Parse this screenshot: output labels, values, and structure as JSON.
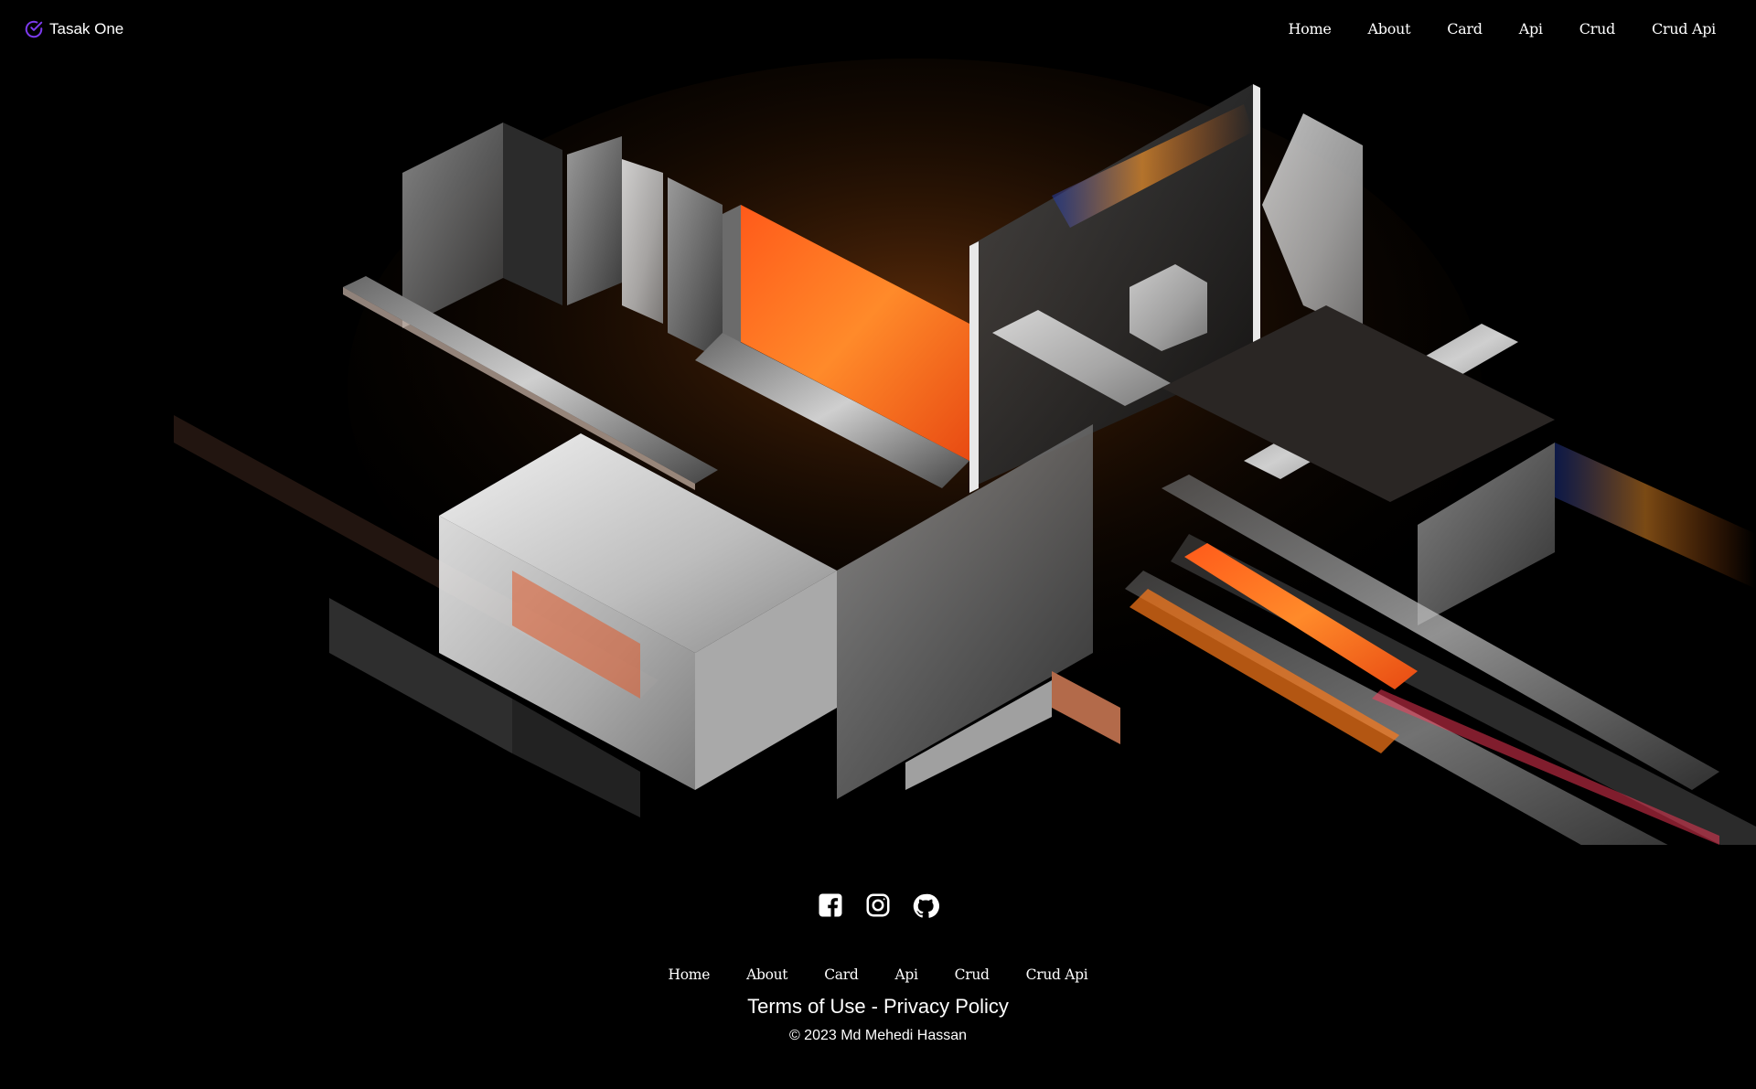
{
  "header": {
    "brand": {
      "name": "Tasak One",
      "icon": "check-circle-icon",
      "accent": "#7c3aed"
    },
    "nav": [
      {
        "label": "Home"
      },
      {
        "label": "About"
      },
      {
        "label": "Card"
      },
      {
        "label": "Api"
      },
      {
        "label": "Crud"
      },
      {
        "label": "Crud Api"
      }
    ]
  },
  "hero": {
    "image": "abstract-3d-glass-blocks",
    "accent_colors": [
      "#ff7a1a",
      "#e0e0e0",
      "#1c1c1c"
    ]
  },
  "footer": {
    "social": [
      {
        "icon": "facebook-icon"
      },
      {
        "icon": "instagram-icon"
      },
      {
        "icon": "github-icon"
      }
    ],
    "nav": [
      {
        "label": "Home"
      },
      {
        "label": "About"
      },
      {
        "label": "Card"
      },
      {
        "label": "Api"
      },
      {
        "label": "Crud"
      },
      {
        "label": "Crud Api"
      }
    ],
    "terms": "Terms of Use",
    "separator": "-",
    "privacy": "Privacy Policy",
    "copyright": "© 2023 Md Mehedi Hassan"
  }
}
